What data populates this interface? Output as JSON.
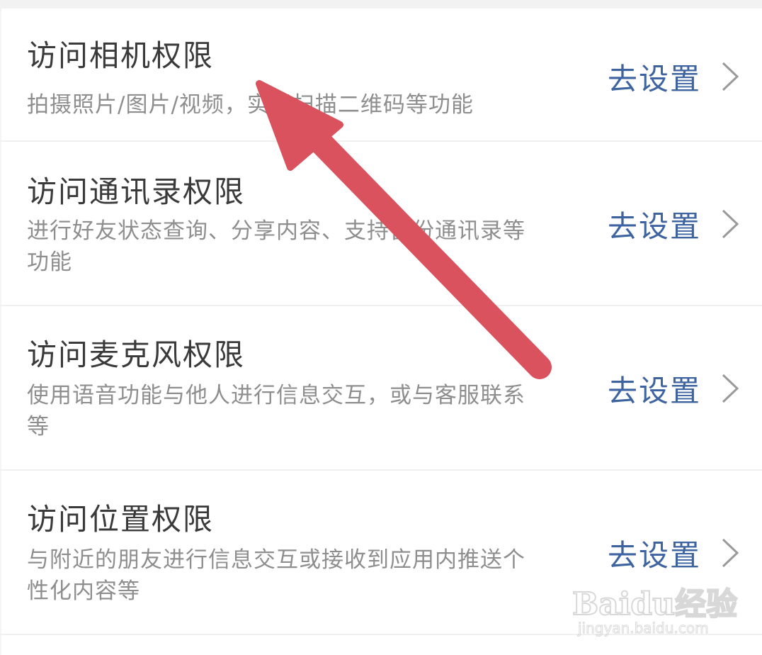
{
  "permissions": [
    {
      "title": "访问相机权限",
      "description": "拍摄照片/图片/视频，实现扫描二维码等功能",
      "action_label": "去设置"
    },
    {
      "title": "访问通讯录权限",
      "description": "进行好友状态查询、分享内容、支持备份通讯录等功能",
      "action_label": "去设置"
    },
    {
      "title": "访问麦克风权限",
      "description": "使用语音功能与他人进行信息交互，或与客服联系等",
      "action_label": "去设置"
    },
    {
      "title": "访问位置权限",
      "description": "与附近的朋友进行信息交互或接收到应用内推送个性化内容等",
      "action_label": "去设置"
    }
  ],
  "watermark": {
    "brand": "Baidu经验",
    "url": "jingyan.baidu.com"
  },
  "colors": {
    "action": "#3d63a0",
    "annotation_arrow": "#d9525e",
    "title": "#3a3a3a",
    "description": "#8e8e8e"
  },
  "icons": {
    "row_chevron": "chevron-right-icon",
    "annotation": "annotation-arrow-icon"
  }
}
